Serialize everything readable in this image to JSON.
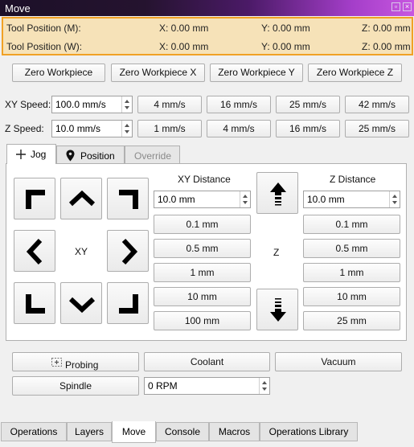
{
  "window": {
    "title": "Move"
  },
  "tool_position": {
    "machine": {
      "label": "Tool Position (M):",
      "x": "X: 0.00 mm",
      "y": "Y: 0.00 mm",
      "z": "Z: 0.00 mm"
    },
    "work": {
      "label": "Tool Position (W):",
      "x": "X: 0.00 mm",
      "y": "Y: 0.00 mm",
      "z": "Z: 0.00 mm"
    }
  },
  "zero_buttons": [
    "Zero Workpiece",
    "Zero Workpiece X",
    "Zero Workpiece Y",
    "Zero Workpiece Z"
  ],
  "xy_speed": {
    "label": "XY Speed:",
    "value": "100.0 mm/s",
    "presets": [
      "4 mm/s",
      "16 mm/s",
      "25 mm/s",
      "42 mm/s"
    ]
  },
  "z_speed": {
    "label": "Z Speed:",
    "value": "10.0 mm/s",
    "presets": [
      "1 mm/s",
      "4 mm/s",
      "16 mm/s",
      "25 mm/s"
    ]
  },
  "tabs": [
    {
      "label": "Jog",
      "icon": "move-cross-icon",
      "active": true
    },
    {
      "label": "Position",
      "icon": "map-pin-icon",
      "active": false
    },
    {
      "label": "Override",
      "icon": "",
      "active": false,
      "disabled": true
    }
  ],
  "jog": {
    "xy_label": "XY",
    "z_label": "Z",
    "xy_distance": {
      "title": "XY Distance",
      "value": "10.0 mm",
      "presets": [
        "0.1 mm",
        "0.5 mm",
        "1 mm",
        "10 mm",
        "100 mm"
      ]
    },
    "z_distance": {
      "title": "Z Distance",
      "value": "10.0 mm",
      "presets": [
        "0.1 mm",
        "0.5 mm",
        "1 mm",
        "10 mm",
        "25 mm"
      ]
    }
  },
  "actions": {
    "probing": "Probing",
    "coolant": "Coolant",
    "vacuum": "Vacuum",
    "spindle": "Spindle",
    "rpm": "0 RPM"
  },
  "bottom_tabs": [
    "Operations",
    "Layers",
    "Move",
    "Console",
    "Macros",
    "Operations Library"
  ],
  "colors": {
    "position_bg": "#f6e2b8",
    "position_border": "#f0a125",
    "title_gradient_end": "#c857e0"
  }
}
